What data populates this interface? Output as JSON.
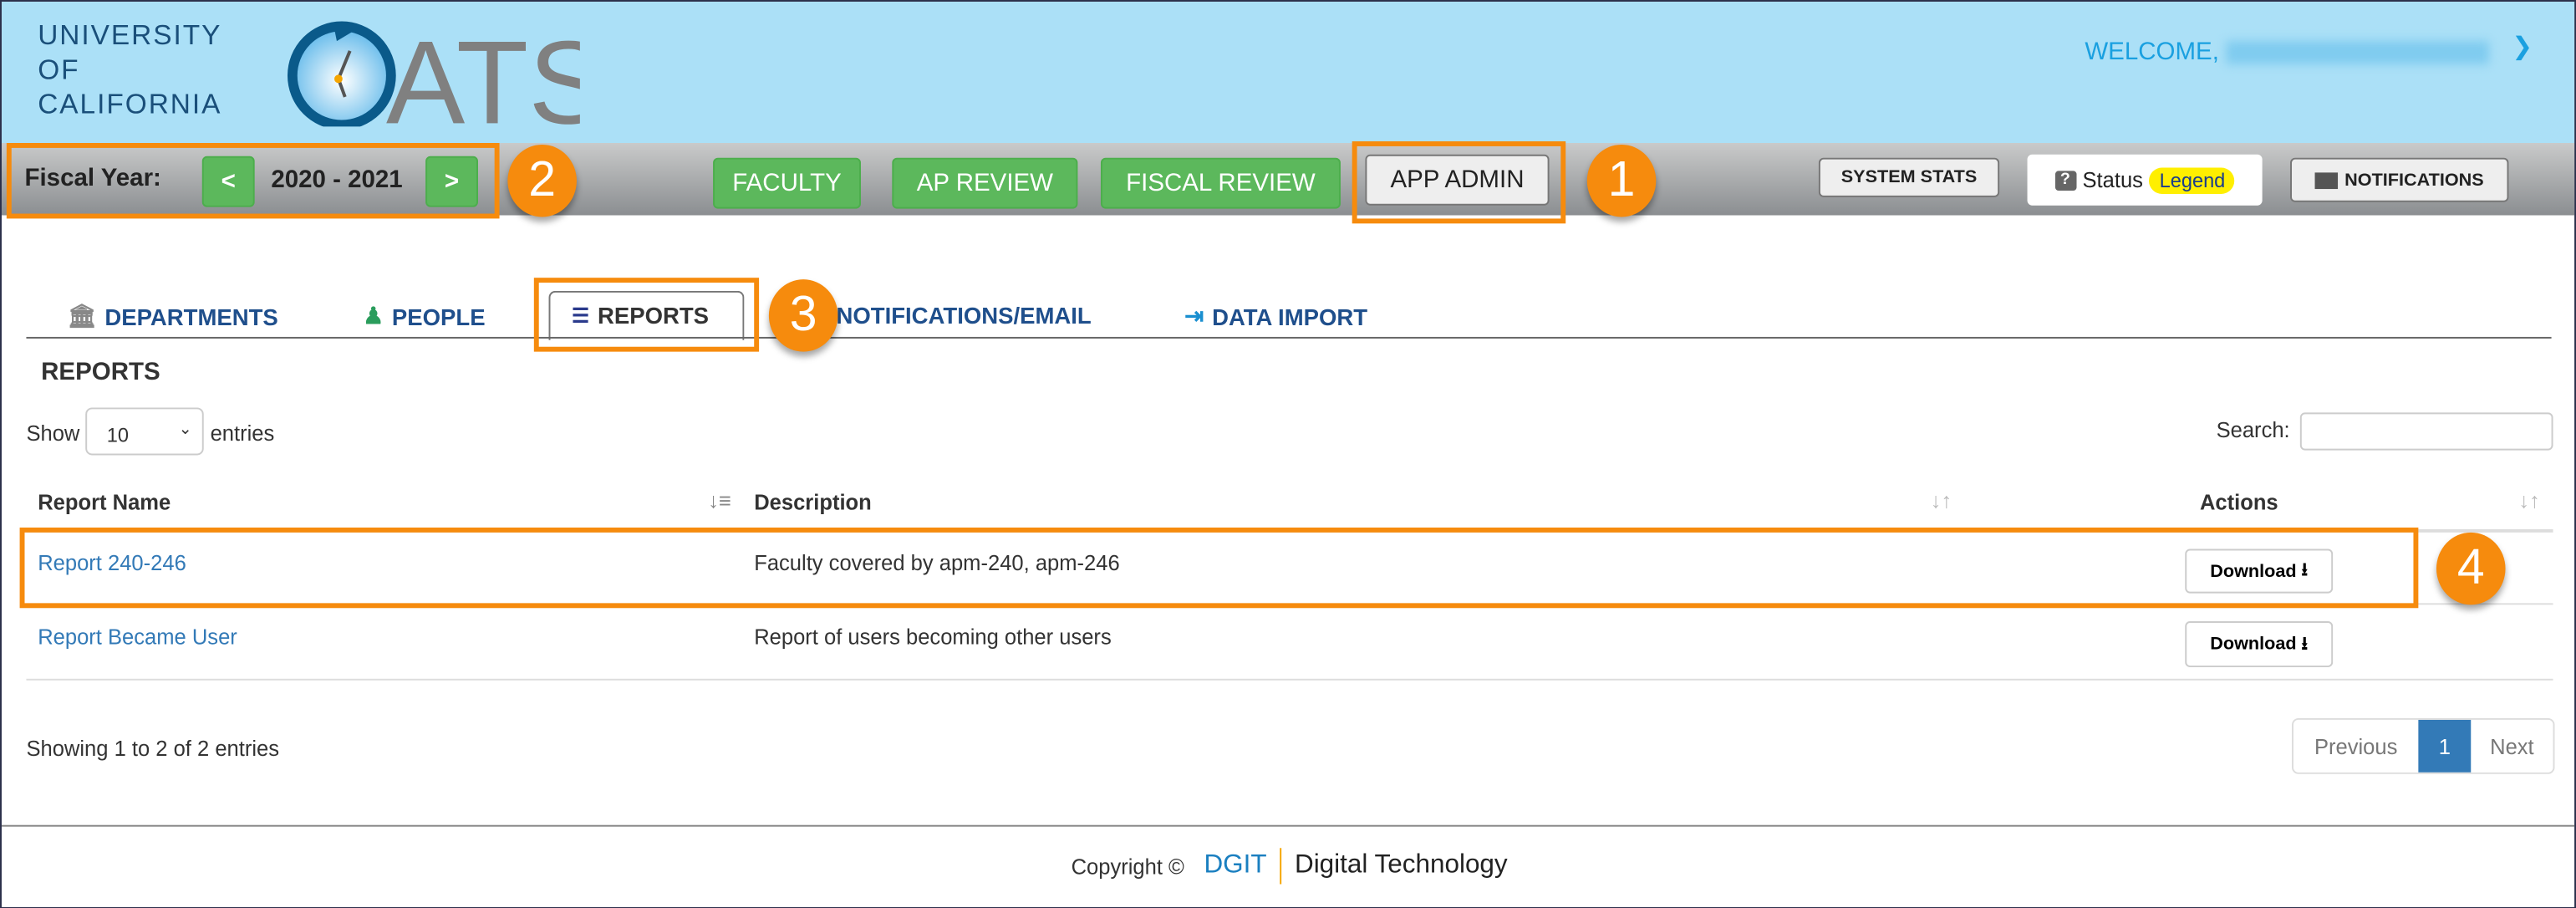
{
  "header": {
    "org_lines": [
      "UNIVERSITY",
      "OF",
      "CALIFORNIA"
    ],
    "app_logo": "OATS",
    "welcome": "WELCOME,",
    "user_menu_icon": "chevron-down-icon",
    "colors": {
      "header_bg": "#abe0f7",
      "accent": "#1aa0e0"
    }
  },
  "fiscal_year": {
    "label": "Fiscal Year:",
    "prev": "<",
    "value": "2020 - 2021",
    "next": ">"
  },
  "nav": {
    "items": [
      "FACULTY",
      "AP REVIEW",
      "FISCAL REVIEW",
      "APP ADMIN"
    ],
    "active": "APP ADMIN",
    "green": "#5cb85c"
  },
  "tools": {
    "system_stats": "SYSTEM STATS",
    "status": "Status",
    "legend": "Legend",
    "notifications": "NOTIFICATIONS"
  },
  "tabs": [
    {
      "label": "DEPARTMENTS",
      "icon": "building-icon"
    },
    {
      "label": "PEOPLE",
      "icon": "people-icon"
    },
    {
      "label": "REPORTS",
      "icon": "chart-list-icon",
      "active": true
    },
    {
      "label": "NOTIFICATIONS/EMAIL"
    },
    {
      "label": "DATA IMPORT",
      "icon": "import-icon"
    }
  ],
  "callouts": [
    "1",
    "2",
    "3",
    "4"
  ],
  "reports": {
    "heading": "REPORTS",
    "show": "Show",
    "entries_value": "10",
    "entries": "entries",
    "search_label": "Search:",
    "search_value": "",
    "columns": [
      "Report Name",
      "Description",
      "Actions"
    ],
    "rows": [
      {
        "name": "Report 240-246",
        "description": "Faculty covered by apm-240, apm-246",
        "action": "Download"
      },
      {
        "name": "Report Became User",
        "description": "Report of users becoming other users",
        "action": "Download"
      }
    ],
    "info": "Showing 1 to 2 of 2 entries",
    "pagination": {
      "previous": "Previous",
      "current": "1",
      "next": "Next"
    }
  },
  "footer": {
    "copyright": "Copyright ©",
    "brand": "DGIT",
    "brand_full": "Digital Technology"
  }
}
